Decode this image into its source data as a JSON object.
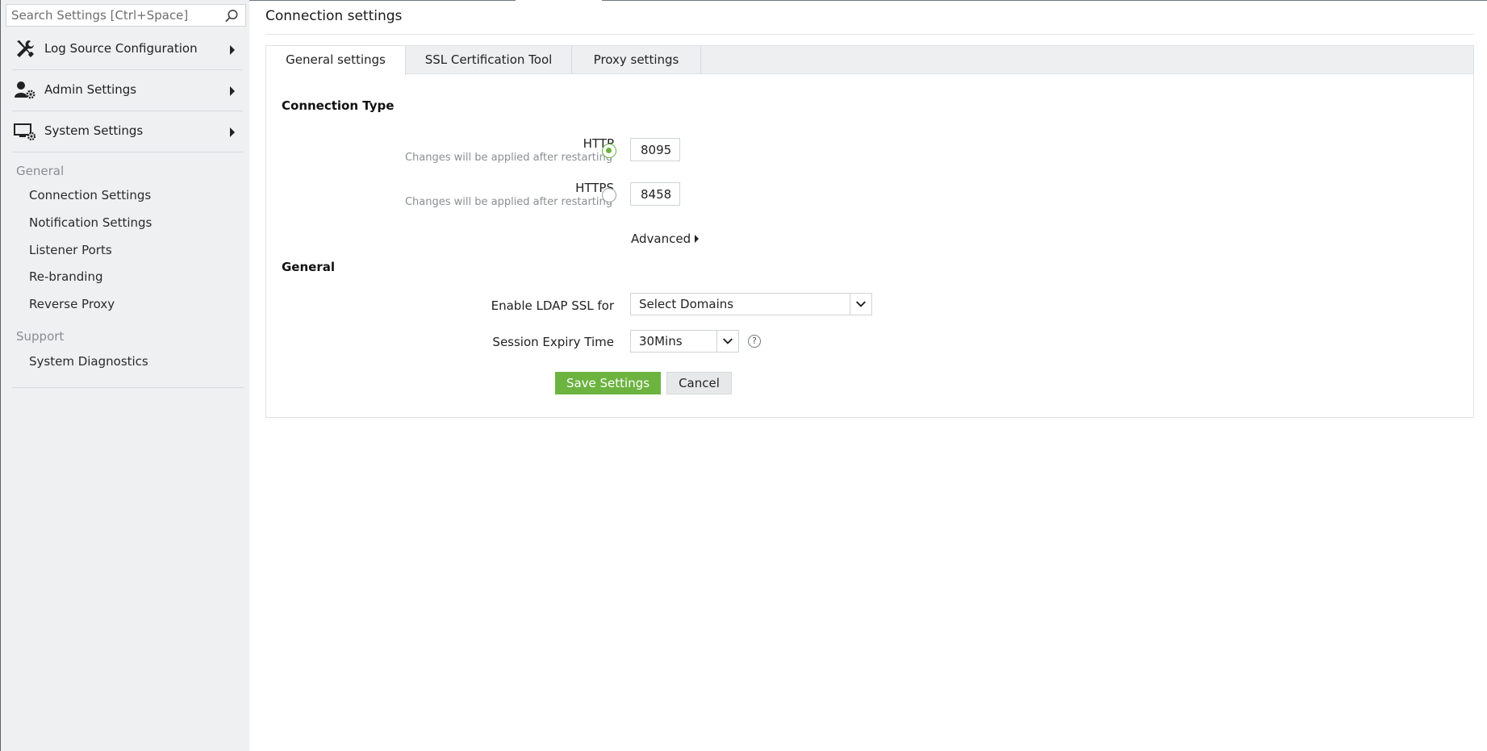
{
  "search": {
    "placeholder": "Search Settings [Ctrl+Space]",
    "icon": "search-icon"
  },
  "sidebar": {
    "groups": [
      {
        "label": "Log Source Configuration",
        "icon": "tools-icon"
      },
      {
        "label": "Admin Settings",
        "icon": "user-gear-icon"
      },
      {
        "label": "System Settings",
        "icon": "monitor-gear-icon"
      }
    ],
    "sections": [
      {
        "title": "General",
        "items": [
          "Connection Settings",
          "Notification Settings",
          "Listener Ports",
          "Re-branding",
          "Reverse Proxy"
        ]
      },
      {
        "title": "Support",
        "items": [
          "System Diagnostics"
        ]
      }
    ]
  },
  "page": {
    "title": "Connection settings"
  },
  "tabs": [
    {
      "label": "General settings",
      "active": true
    },
    {
      "label": "SSL Certification Tool",
      "active": false
    },
    {
      "label": "Proxy settings",
      "active": false
    }
  ],
  "connection": {
    "heading": "Connection Type",
    "http": {
      "label": "HTTP",
      "hint": "Changes will be applied after restarting",
      "port": "8095",
      "selected": true
    },
    "https": {
      "label": "HTTPS",
      "hint": "Changes will be applied after restarting",
      "port": "8458",
      "selected": false
    },
    "advanced_label": "Advanced"
  },
  "general": {
    "heading": "General",
    "ldap_label": "Enable LDAP SSL for",
    "ldap_value": "Select Domains",
    "session_label": "Session Expiry Time",
    "session_value": "30Mins",
    "help_glyph": "?"
  },
  "actions": {
    "save_label": "Save Settings",
    "cancel_label": "Cancel"
  },
  "colors": {
    "accent": "#6cb33f",
    "sidebar_bg": "#eef0f1",
    "tabbar_bg": "#edeff0"
  }
}
